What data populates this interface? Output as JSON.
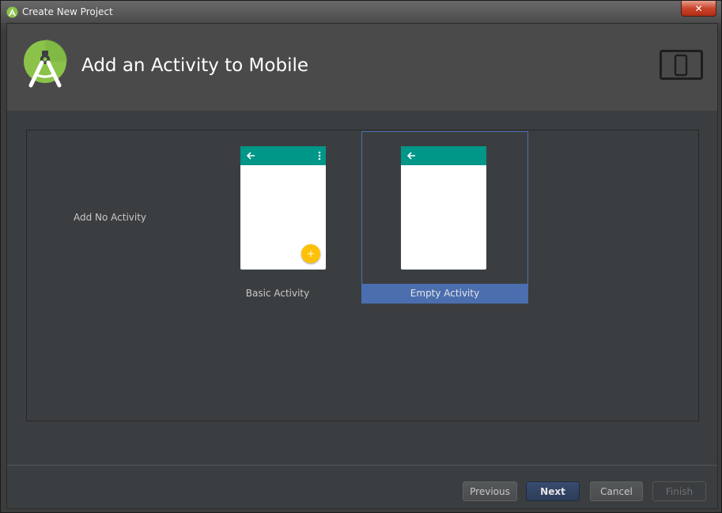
{
  "window": {
    "title": "Create New Project",
    "close_label": "✕"
  },
  "header": {
    "title": "Add an Activity to Mobile"
  },
  "gallery": {
    "items": [
      {
        "label": "Add No Activity"
      },
      {
        "label": "Basic Activity"
      },
      {
        "label": "Empty Activity",
        "selected": true
      }
    ]
  },
  "footer": {
    "previous_label": "Previous",
    "next_label": "Next",
    "cancel_label": "Cancel",
    "finish_label": "Finish"
  },
  "colors": {
    "app_bar": "#009688",
    "fab": "#ffc107",
    "selection": "#4b6eaf",
    "android_green": "#8bc34a"
  },
  "icons": {
    "window": "android-studio-icon",
    "header": "android-studio-logo",
    "device": "phone-tablet-icon",
    "back": "arrow-back-icon",
    "menu": "overflow-menu-icon",
    "fab": "plus-icon"
  }
}
